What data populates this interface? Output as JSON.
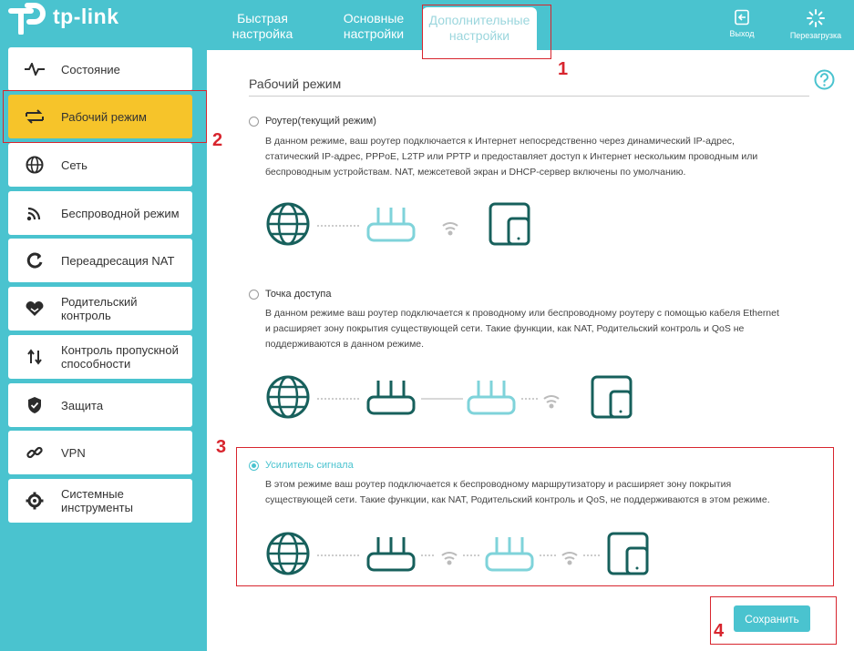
{
  "brand": {
    "logo_text": "tp-link"
  },
  "header": {
    "tabs": [
      {
        "label_line1": "Быстрая",
        "label_line2": "настройка"
      },
      {
        "label_line1": "Основные",
        "label_line2": "настройки"
      },
      {
        "label_line1": "Дополнительные",
        "label_line2": "настройки"
      }
    ],
    "logout_label": "Выход",
    "reboot_label": "Перезагрузка"
  },
  "annotations": [
    "1",
    "2",
    "3",
    "4"
  ],
  "sidebar": {
    "items": [
      {
        "label": "Состояние",
        "icon": "status-icon"
      },
      {
        "label": "Рабочий режим",
        "icon": "operation-mode-icon"
      },
      {
        "label": "Сеть",
        "icon": "network-icon"
      },
      {
        "label": "Беспроводной режим",
        "icon": "wireless-icon"
      },
      {
        "label": "Переадресация NAT",
        "icon": "nat-icon"
      },
      {
        "label_line1": "Родительский",
        "label_line2": "контроль",
        "icon": "parental-control-icon"
      },
      {
        "label_line1": "Контроль пропускной",
        "label_line2": "способности",
        "icon": "bandwidth-icon"
      },
      {
        "label": "Защита",
        "icon": "security-icon"
      },
      {
        "label": "VPN",
        "icon": "vpn-icon"
      },
      {
        "label_line1": "Системные",
        "label_line2": "инструменты",
        "icon": "system-tools-icon"
      }
    ]
  },
  "main": {
    "section_title": "Рабочий режим",
    "options": [
      {
        "label": "Роутер(текущий режим)",
        "desc": [
          "В данном режиме, ваш роутер подключается к Интернет непосредственно через динамический IP-адрес,",
          "статический IP-адрес, PPPoE, L2TP или PPTP и предоставляет доступ к Интернет нескольким проводным или",
          "беспроводным устройствам. NAT, межсетевой экран и DHCP-сервер включены по умолчанию."
        ],
        "selected": false
      },
      {
        "label": "Точка доступа",
        "desc": [
          "В данном режиме ваш роутер подключается к проводному или беспроводному роутеру с помощью кабеля Ethernet",
          "и расширяет зону покрытия существующей сети. Такие функции, как NAT, Родительский контроль и QoS не",
          "поддерживаются в данном режиме."
        ],
        "selected": false
      },
      {
        "label": "Усилитель сигнала",
        "desc": [
          "В этом режиме ваш роутер подключается к беспроводному маршрутизатору и расширяет зону покрытия",
          "существующей сети. Такие функции, как NAT, Родительский контроль и QoS, не поддерживаются в этом режиме."
        ],
        "selected": true
      }
    ],
    "save_label": "Сохранить"
  },
  "colors": {
    "accent": "#4ac3cf",
    "active_nav": "#f6c42a",
    "annotation": "#d8252e",
    "icon_dark": "#17605c"
  }
}
